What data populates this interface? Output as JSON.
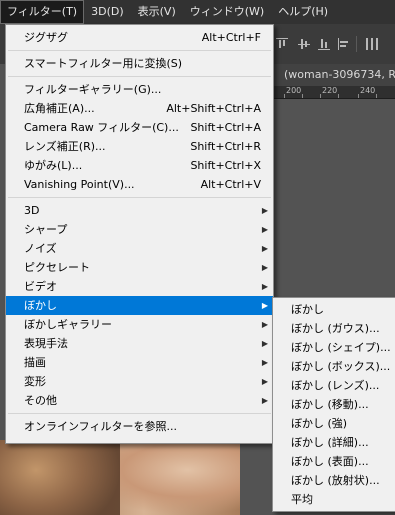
{
  "menubar": {
    "items": [
      {
        "label": "フィルター(T)"
      },
      {
        "label": "3D(D)"
      },
      {
        "label": "表示(V)"
      },
      {
        "label": "ウィンドウ(W)"
      },
      {
        "label": "ヘルプ(H)"
      }
    ]
  },
  "document": {
    "tab_title": "(woman-3096734, RC",
    "ruler_labels": [
      "200",
      "220",
      "240"
    ]
  },
  "filter_menu": {
    "group1": [
      {
        "label": "ジグザグ",
        "shortcut": "Alt+Ctrl+F"
      }
    ],
    "group2": [
      {
        "label": "スマートフィルター用に変換(S)"
      }
    ],
    "group3": [
      {
        "label": "フィルターギャラリー(G)..."
      },
      {
        "label": "広角補正(A)...",
        "shortcut": "Alt+Shift+Ctrl+A"
      },
      {
        "label": "Camera Raw フィルター(C)...",
        "shortcut": "Shift+Ctrl+A"
      },
      {
        "label": "レンズ補正(R)...",
        "shortcut": "Shift+Ctrl+R"
      },
      {
        "label": "ゆがみ(L)...",
        "shortcut": "Shift+Ctrl+X"
      },
      {
        "label": "Vanishing Point(V)...",
        "shortcut": "Alt+Ctrl+V"
      }
    ],
    "group4": [
      {
        "label": "3D"
      },
      {
        "label": "シャープ"
      },
      {
        "label": "ノイズ"
      },
      {
        "label": "ピクセレート"
      },
      {
        "label": "ビデオ"
      },
      {
        "label": "ぼかし"
      },
      {
        "label": "ぼかしギャラリー"
      },
      {
        "label": "表現手法"
      },
      {
        "label": "描画"
      },
      {
        "label": "変形"
      },
      {
        "label": "その他"
      }
    ],
    "group5": [
      {
        "label": "オンラインフィルターを参照..."
      }
    ]
  },
  "blur_submenu": {
    "items": [
      {
        "label": "ぼかし"
      },
      {
        "label": "ぼかし (ガウス)..."
      },
      {
        "label": "ぼかし (シェイプ)..."
      },
      {
        "label": "ぼかし (ボックス)..."
      },
      {
        "label": "ぼかし (レンズ)..."
      },
      {
        "label": "ぼかし (移動)..."
      },
      {
        "label": "ぼかし (強)"
      },
      {
        "label": "ぼかし (詳細)..."
      },
      {
        "label": "ぼかし (表面)..."
      },
      {
        "label": "ぼかし (放射状)..."
      },
      {
        "label": "平均"
      }
    ]
  },
  "colors": {
    "highlight": "#0078d7",
    "menu_bg": "#f0f0f0",
    "menubar_bg": "#323232"
  }
}
